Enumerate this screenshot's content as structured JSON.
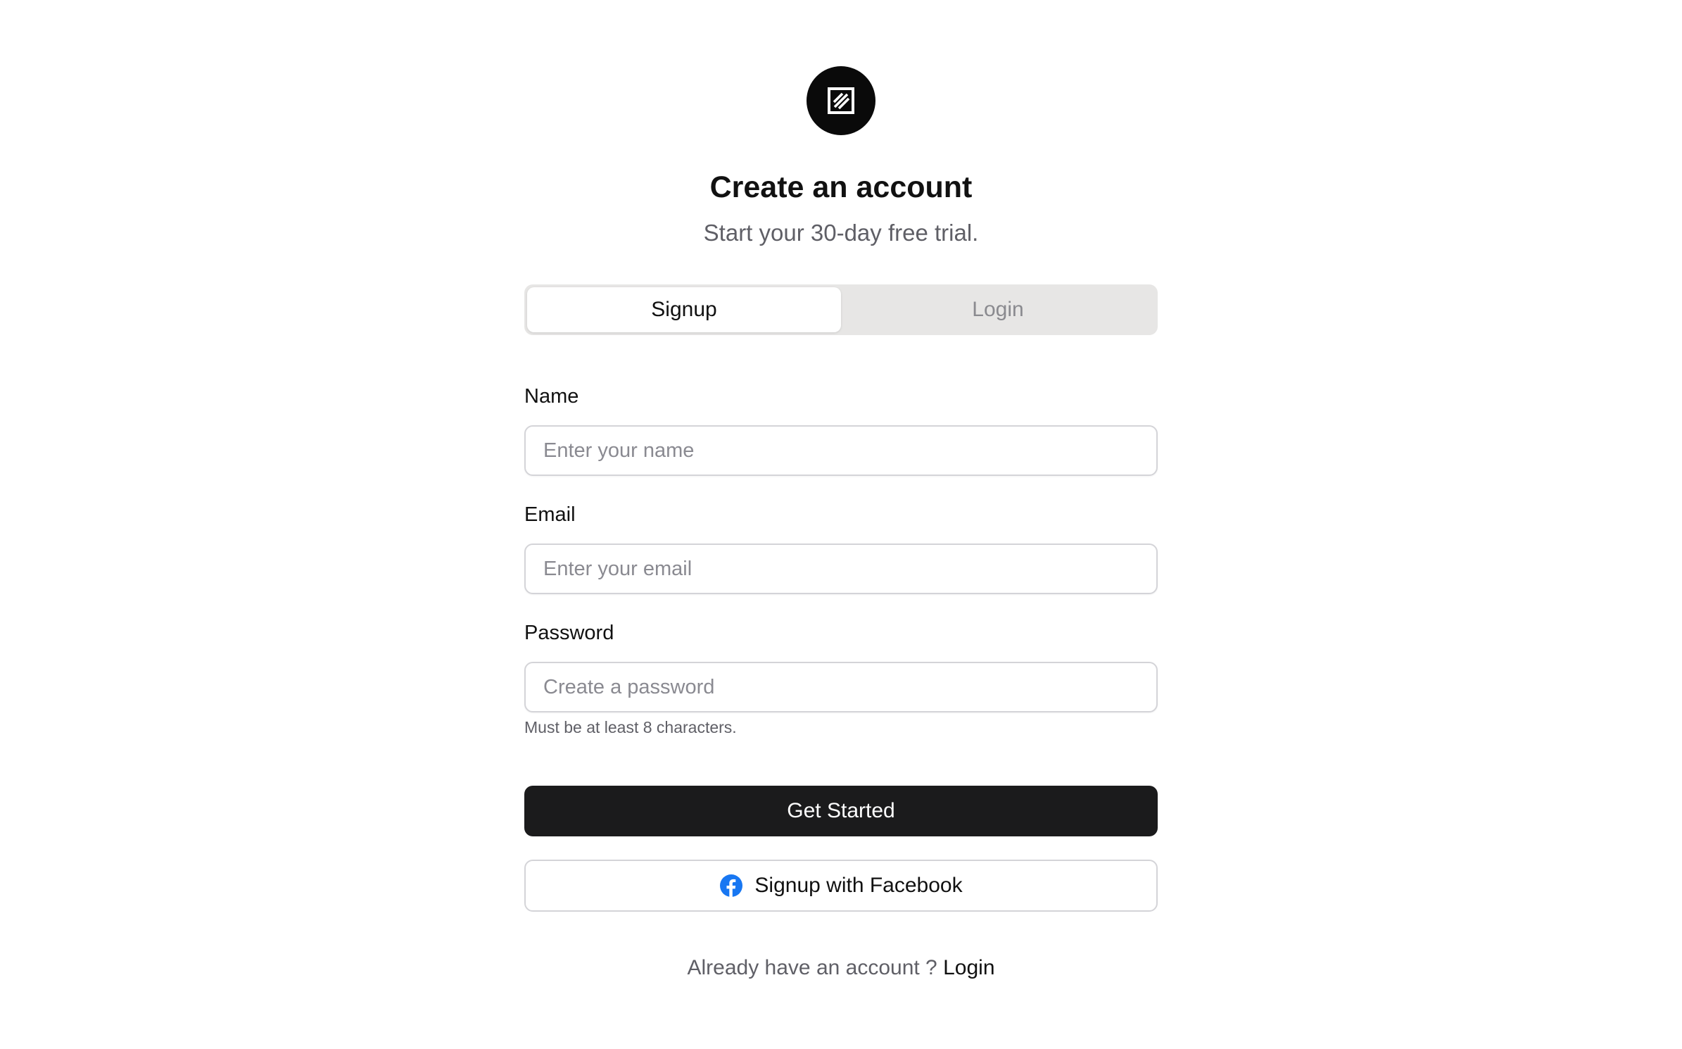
{
  "logo": {
    "icon": "square-diagonal-lines-icon"
  },
  "header": {
    "title": "Create an account",
    "subtitle": "Start your 30-day free trial."
  },
  "tabs": [
    {
      "label": "Signup",
      "active": true
    },
    {
      "label": "Login",
      "active": false
    }
  ],
  "form": {
    "name": {
      "label": "Name",
      "placeholder": "Enter your name",
      "value": ""
    },
    "email": {
      "label": "Email",
      "placeholder": "Enter your email",
      "value": ""
    },
    "password": {
      "label": "Password",
      "placeholder": "Create a password",
      "value": "",
      "hint": "Must be at least 8 characters."
    }
  },
  "buttons": {
    "primary_label": "Get Started",
    "facebook_label": "Signup with Facebook",
    "facebook_icon": "facebook-icon"
  },
  "footer": {
    "text": "Already have an account ?",
    "link_label": "Login"
  },
  "colors": {
    "primary_button": "#1b1b1c",
    "facebook_blue": "#1877f2",
    "tab_track": "#e7e6e5"
  }
}
